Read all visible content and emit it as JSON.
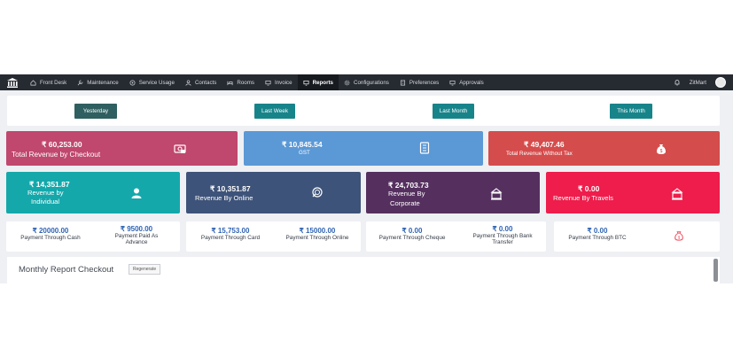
{
  "nav": {
    "items": [
      {
        "label": "Front Desk",
        "icon": "home-icon"
      },
      {
        "label": "Maintenance",
        "icon": "wrench-icon"
      },
      {
        "label": "Service Usage",
        "icon": "service-icon"
      },
      {
        "label": "Contacts",
        "icon": "person-icon"
      },
      {
        "label": "Rooms",
        "icon": "bed-icon"
      },
      {
        "label": "Invoice",
        "icon": "monitor-icon"
      },
      {
        "label": "Reports",
        "icon": "monitor-icon"
      },
      {
        "label": "Configurations",
        "icon": "gear-icon"
      },
      {
        "label": "Preferences",
        "icon": "doc-icon"
      },
      {
        "label": "Approvals",
        "icon": "monitor-icon"
      }
    ],
    "user": "ZitMart"
  },
  "periods": [
    "Yesterday",
    "Last Week",
    "Last Month",
    "This Month"
  ],
  "cards_row1": [
    {
      "amount": "₹ 60,253.00",
      "label": "Total Revenue by Checkout",
      "color": "#c0476e"
    },
    {
      "amount": "₹ 10,845.54",
      "label": "GST",
      "color": "#5b98d6"
    },
    {
      "amount": "₹ 49,407.46",
      "label": "Total Revenue Without Tax",
      "color": "#d54c4c"
    }
  ],
  "cards_row2": [
    {
      "amount": "₹ 14,351.87",
      "label1": "Revenue by",
      "label2": "Individual",
      "color": "#14a8ab"
    },
    {
      "amount": "₹ 10,351.87",
      "label1": "Revenue By Online",
      "label2": "",
      "color": "#3e5379"
    },
    {
      "amount": "₹ 24,703.73",
      "label1": "Revenue By",
      "label2": "Corporate",
      "color": "#55305f"
    },
    {
      "amount": "₹ 0.00",
      "label1": "Revenue By Travels",
      "label2": "",
      "color": "#ee1d4b"
    }
  ],
  "payments": [
    {
      "amount": "₹ 20000.00",
      "label": "Payment Through Cash"
    },
    {
      "amount": "₹ 9500.00",
      "label": "Payment Paid As Advance"
    },
    {
      "amount": "₹ 15,753.00",
      "label": "Payment Through Card"
    },
    {
      "amount": "₹ 15000.00",
      "label": "Payment Through Online"
    },
    {
      "amount": "₹ 0.00",
      "label": "Payment Through Cheque"
    },
    {
      "amount": "₹ 0.00",
      "label": "Payment Through Bank Transfer"
    },
    {
      "amount": "₹ 0.00",
      "label": "Payment Through BTC"
    }
  ],
  "monthly": {
    "title": "Monthly Report Checkout",
    "button": "Regenerate"
  }
}
